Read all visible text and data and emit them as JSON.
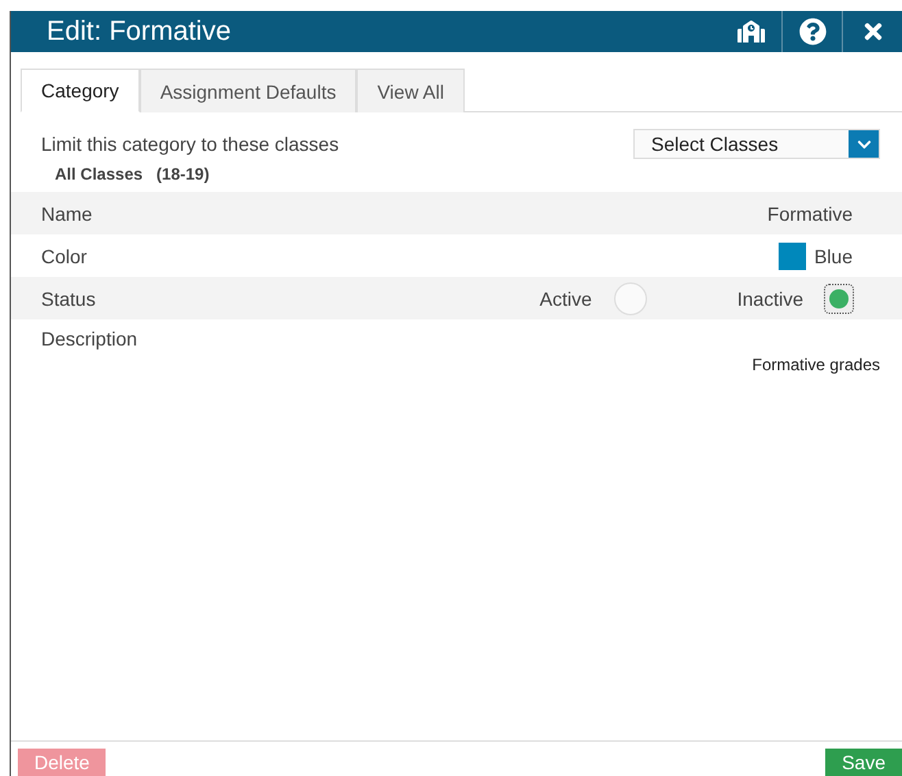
{
  "window": {
    "title": "Edit: Formative"
  },
  "header_buttons": [
    {
      "kind": "school"
    },
    {
      "kind": "help"
    },
    {
      "kind": "close"
    }
  ],
  "tabs": [
    {
      "label": "Category",
      "selected": true
    },
    {
      "label": "Assignment Defaults",
      "selected": false
    },
    {
      "label": "View All",
      "selected": false
    }
  ],
  "limit": {
    "label": "Limit this category to these classes",
    "dropdown": "Select Classes",
    "classes_label": "All Classes",
    "classes_year": "(18-19)"
  },
  "rows": [
    {
      "kind": "text",
      "label": "Name",
      "value": "Formative"
    },
    {
      "kind": "color",
      "label": "Color",
      "value": "Blue",
      "color": "#0088bb"
    },
    {
      "kind": "radio",
      "label": "Status",
      "options": [
        {
          "label": "Active",
          "selected": false
        },
        {
          "label": "Inactive",
          "selected": true
        }
      ]
    },
    {
      "kind": "description",
      "label": "Description",
      "value": "Formative grades"
    }
  ],
  "footer": {
    "delete": {
      "label": "Delete",
      "disabled": true
    },
    "save": {
      "label": "Save"
    }
  }
}
